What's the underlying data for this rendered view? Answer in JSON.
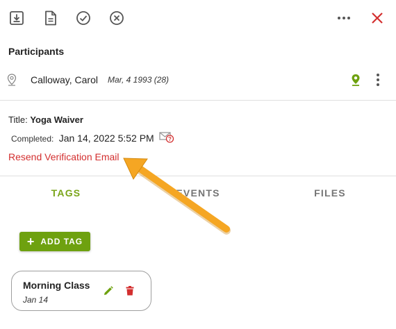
{
  "toolbar": {
    "icons": [
      "download-icon",
      "document-icon",
      "check-circle-icon",
      "cancel-circle-icon",
      "more-horizontal-icon",
      "close-icon"
    ],
    "close_color": "#d32f2f"
  },
  "participants": {
    "heading": "Participants",
    "items": [
      {
        "name": "Calloway, Carol",
        "dob": "Mar, 4 1993 (28)"
      }
    ],
    "location_icon_color": "#6ea10f"
  },
  "waiver": {
    "title_label": "Title:",
    "title_value": "Yoga Waiver",
    "completed_label": "Completed:",
    "completed_value": "Jan 14, 2022 5:52 PM",
    "resend_label": "Resend Verification Email",
    "link_color": "#d32f2f"
  },
  "tabs": [
    {
      "label": "TAGS",
      "active": true
    },
    {
      "label": "EVENTS",
      "active": false
    },
    {
      "label": "FILES",
      "active": false
    }
  ],
  "tags_panel": {
    "add_button_label": "ADD TAG",
    "accent_color": "#6ea10f",
    "tags": [
      {
        "name": "Morning Class",
        "date": "Jan 14"
      }
    ]
  },
  "annotation": {
    "arrow_color": "#f5a623"
  }
}
